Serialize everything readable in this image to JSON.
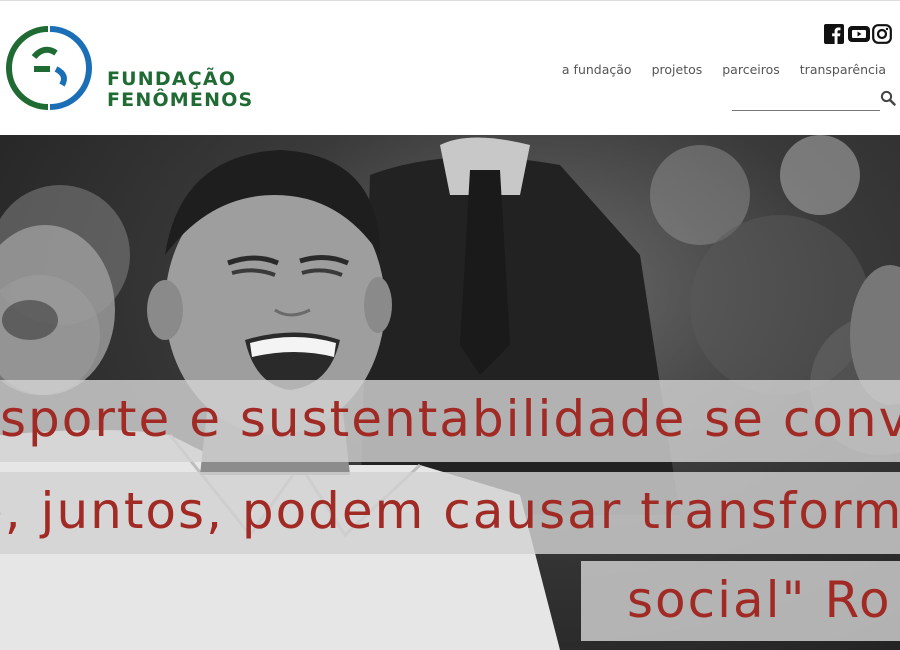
{
  "brand": {
    "line1": "FUNDAÇÃO",
    "line2": "FENÔMENOS"
  },
  "social": {
    "icons": [
      "facebook-icon",
      "youtube-icon",
      "instagram-icon"
    ]
  },
  "nav": {
    "items": [
      "a fundação",
      "projetos",
      "parceiros",
      "transparência"
    ]
  },
  "search": {
    "placeholder": "",
    "value": ""
  },
  "hero": {
    "quote_line1": "sporte e sustentabilidade se conv",
    "quote_line2": "e, juntos, podem causar transform",
    "quote_line3": "social\" Ro"
  },
  "colors": {
    "brand_green": "#1f6b33",
    "logo_blue": "#1b6fb6",
    "quote_red": "#a12a25"
  }
}
